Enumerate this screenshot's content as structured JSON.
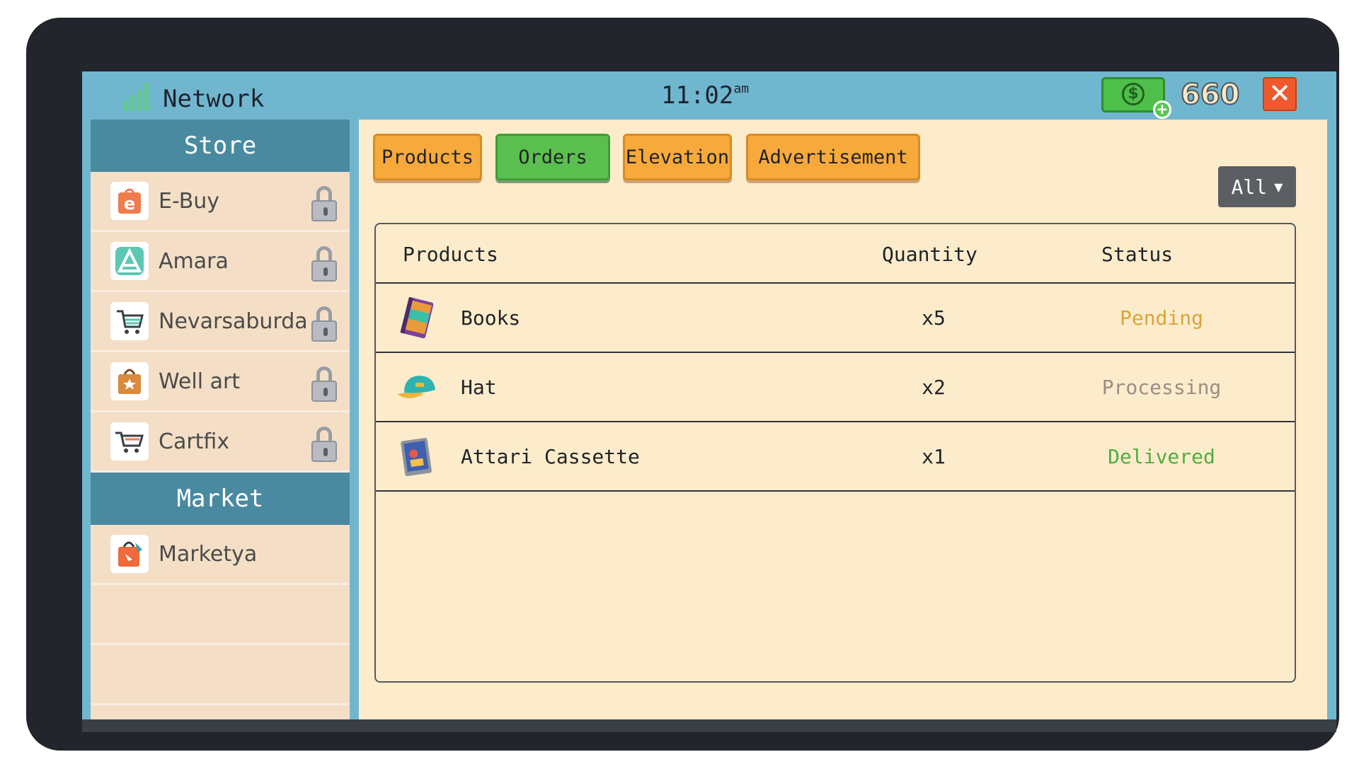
{
  "topbar": {
    "network_label": "Network",
    "clock_time": "11:02",
    "clock_suffix": "am",
    "money_symbol": "$",
    "money_plus": "+",
    "money_value": "660",
    "close_symbol": "✕"
  },
  "sidebar": {
    "store_header": "Store",
    "store_items": [
      {
        "label": "E-Buy",
        "icon": "e-buy-icon",
        "locked": true
      },
      {
        "label": "Amara",
        "icon": "amara-icon",
        "locked": true
      },
      {
        "label": "Nevarsaburda",
        "icon": "cart-icon",
        "locked": true
      },
      {
        "label": "Well art",
        "icon": "shopping-bag-icon",
        "locked": true
      },
      {
        "label": "Cartfix",
        "icon": "cart-icon",
        "locked": true
      }
    ],
    "market_header": "Market",
    "market_items": [
      {
        "label": "Marketya",
        "icon": "market-bag-icon",
        "locked": false
      }
    ]
  },
  "tabs": [
    {
      "label": "Products",
      "active": false
    },
    {
      "label": "Orders",
      "active": true
    },
    {
      "label": "Elevation",
      "active": false
    },
    {
      "label": "Advertisement",
      "active": false
    }
  ],
  "filter": {
    "label": "All",
    "arrow": "▼"
  },
  "orders_table": {
    "headers": {
      "product": "Products",
      "quantity": "Quantity",
      "status": "Status"
    },
    "rows": [
      {
        "product": "Books",
        "icon": "book-icon",
        "quantity": "x5",
        "status": "Pending"
      },
      {
        "product": "Hat",
        "icon": "cap-icon",
        "quantity": "x2",
        "status": "Processing"
      },
      {
        "product": "Attari Cassette",
        "icon": "cassette-icon",
        "quantity": "x1",
        "status": "Delivered"
      }
    ]
  },
  "colors": {
    "status_pending": "#d9a53a",
    "status_processing": "#9a8e86",
    "status_delivered": "#4fae3f",
    "tab_orange": "#f7a93b",
    "tab_green": "#5bbf4f",
    "header_blue": "#4a8aa1",
    "frame_blue": "#71b6cf"
  }
}
